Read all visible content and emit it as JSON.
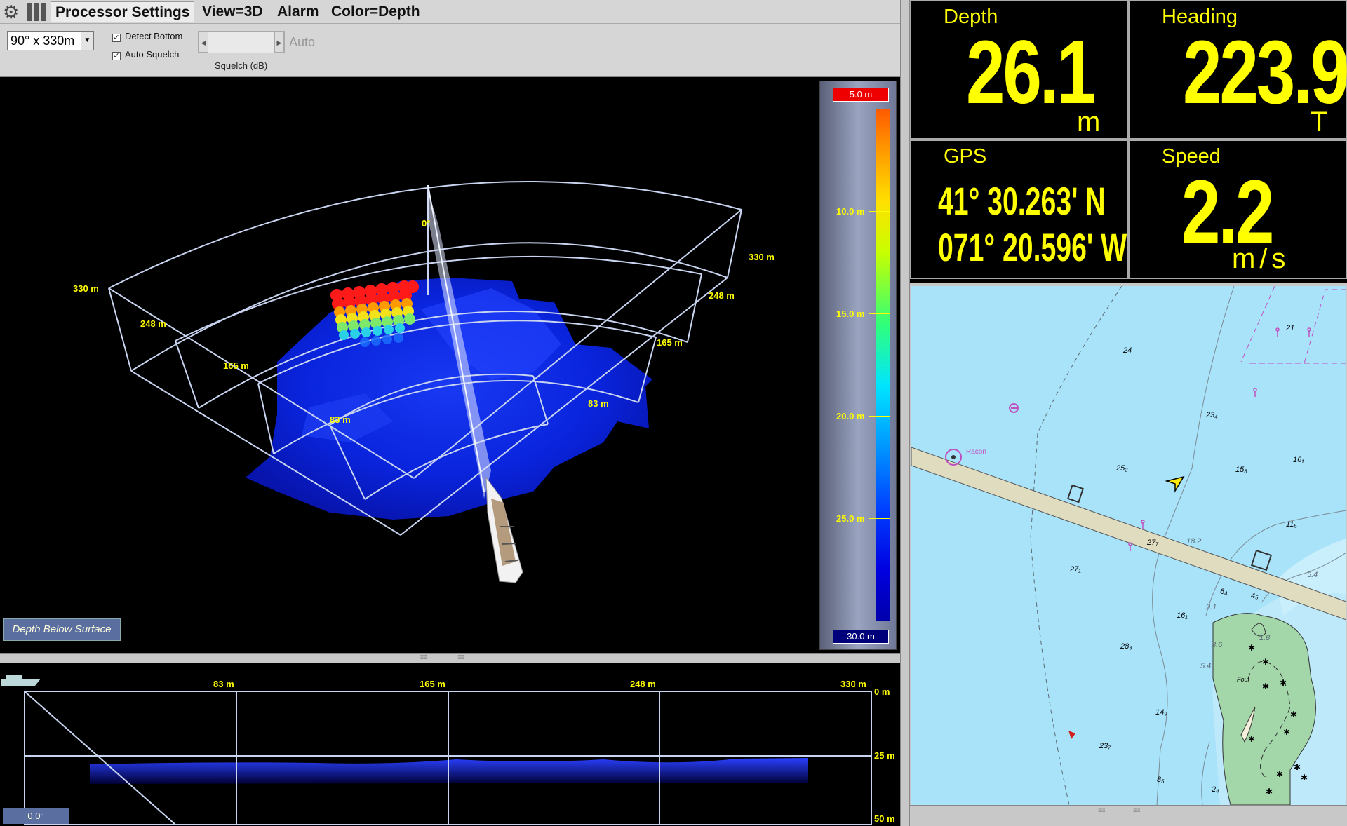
{
  "menubar": {
    "processor_settings": "Processor Settings",
    "view": "View=3D",
    "alarm": "Alarm",
    "color": "Color=Depth"
  },
  "toolbar": {
    "range_value": "90° x 330m",
    "detect_bottom": "Detect Bottom",
    "auto_squelch": "Auto Squelch",
    "slider_auto": "Auto",
    "squelch_label": "Squelch (dB)"
  },
  "view3d": {
    "heading_label": "0°",
    "range_labels_left": [
      "330 m",
      "248 m",
      "165 m",
      "83 m"
    ],
    "range_labels_right": [
      "330 m",
      "248 m",
      "165 m",
      "83 m"
    ],
    "colorbar": {
      "top": "5.0 m",
      "bottom": "30.0 m",
      "ticks": [
        "10.0 m",
        "15.0 m",
        "20.0 m",
        "25.0 m"
      ]
    },
    "depth_mode_button": "Depth Below Surface"
  },
  "sideview": {
    "range_labels": [
      "83 m",
      "165 m",
      "248 m",
      "330 m"
    ],
    "depth_labels": [
      "0 m",
      "25 m",
      "50 m"
    ],
    "angle": "0.0°"
  },
  "instruments": {
    "depth": {
      "label": "Depth",
      "value": "26.1",
      "unit": "m"
    },
    "heading": {
      "label": "Heading",
      "value": "223.9",
      "unit": "T"
    },
    "gps": {
      "label": "GPS",
      "lat": "41° 30.263' N",
      "lon": "071° 20.596' W"
    },
    "speed": {
      "label": "Speed",
      "value": "2.2",
      "unit": "m/s"
    }
  },
  "chart": {
    "racon_label": "Racon",
    "foul_label": "Foul",
    "soundings": [
      {
        "t": "21"
      },
      {
        "t": "24"
      },
      {
        "t": "23₄"
      },
      {
        "t": "16₁"
      },
      {
        "t": "15₈"
      },
      {
        "t": "25₂"
      },
      {
        "t": "11₅"
      },
      {
        "t": "27₇"
      },
      {
        "t": "18.2"
      },
      {
        "t": "27₁"
      },
      {
        "t": "6₄"
      },
      {
        "t": "4₅"
      },
      {
        "t": "5.4"
      },
      {
        "t": "9.1"
      },
      {
        "t": "16₁"
      },
      {
        "t": "3.6"
      },
      {
        "t": "1.8"
      },
      {
        "t": "28₃"
      },
      {
        "t": "5.4"
      },
      {
        "t": "14₉"
      },
      {
        "t": "23₇"
      },
      {
        "t": "8₅"
      },
      {
        "t": "2₄"
      }
    ]
  },
  "colors": {
    "instrument_yellow": "#ffff00",
    "water": "#a9e3fa",
    "land": "#a3d6a9",
    "grid": "#c8d4f0"
  }
}
